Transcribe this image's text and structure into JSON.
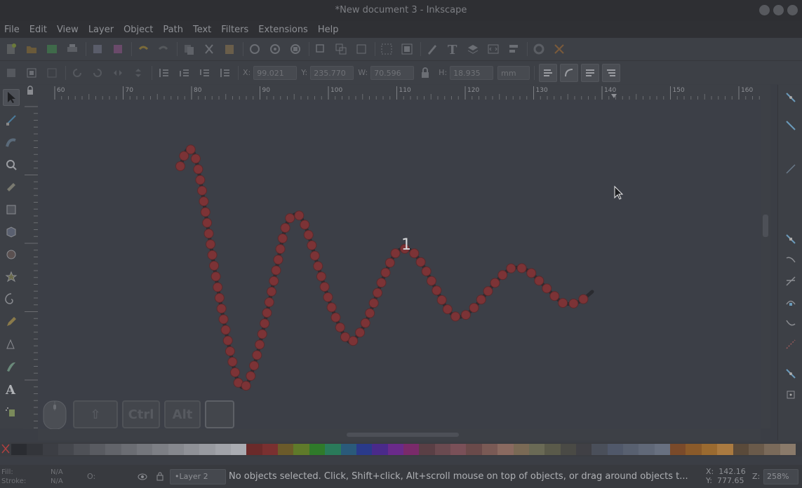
{
  "window": {
    "title": "*New document 3 - Inkscape"
  },
  "menubar": {
    "items": [
      "File",
      "Edit",
      "View",
      "Layer",
      "Object",
      "Path",
      "Text",
      "Filters",
      "Extensions",
      "Help"
    ]
  },
  "controls": {
    "x_label": "X:",
    "x_value": "99.021",
    "y_label": "Y:",
    "y_value": "235.770",
    "w_label": "W:",
    "w_value": "70.596",
    "h_label": "H:",
    "h_value": "18.935",
    "unit": "mm"
  },
  "ruler": {
    "h_ticks": [
      "60",
      "70",
      "80",
      "90",
      "100",
      "110",
      "120",
      "130",
      "140",
      "150",
      "160"
    ]
  },
  "canvas": {
    "annotation": "1",
    "path_color": "#2a2b30",
    "node_color": "#7c3336"
  },
  "key_overlay": {
    "keys": [
      "⇧",
      "Ctrl",
      "Alt",
      ""
    ]
  },
  "palette": {
    "colors": [
      "#2a2c31",
      "#33353a",
      "#3c3e44",
      "#45474d",
      "#4f5157",
      "#595b61",
      "#62646a",
      "#6b6d73",
      "#74767c",
      "#7d7f85",
      "#86888e",
      "#8f9197",
      "#989aa0",
      "#a1a3a9",
      "#aaacb2",
      "#6b2a2a",
      "#7a3030",
      "#6b5a2a",
      "#5f7a2a",
      "#2f7a2a",
      "#2a7a5a",
      "#2a5a7a",
      "#2a3a8a",
      "#4a2a8a",
      "#6a2a8a",
      "#7a2a6a",
      "#5a3f45",
      "#6a4a50",
      "#7a5058",
      "#6a4a4a",
      "#7a5a55",
      "#8a6a60",
      "#7a6a55",
      "#6a6a55",
      "#5a5a4a",
      "#4a4a45",
      "#404045",
      "#4a4f5a",
      "#50586a",
      "#586070",
      "#606878",
      "#687080",
      "#7a4a2a",
      "#8a5a2a",
      "#9a6a30",
      "#aa7a40",
      "#5a4a3a",
      "#6a5a4a",
      "#7a6a5a",
      "#8a7a6a"
    ]
  },
  "status": {
    "fill_label": "Fill:",
    "fill_value": "N/A",
    "stroke_label": "Stroke:",
    "stroke_value": "N/A",
    "opacity_label": "O:",
    "layer": "•Layer 2",
    "message": "No objects selected. Click, Shift+click, Alt+scroll mouse on top of objects, or drag around objects t...",
    "x_label": "X:",
    "x_value": "142.16",
    "y_label": "Y:",
    "y_value": "777.65",
    "zoom_label": "Z:",
    "zoom_value": "258%"
  }
}
